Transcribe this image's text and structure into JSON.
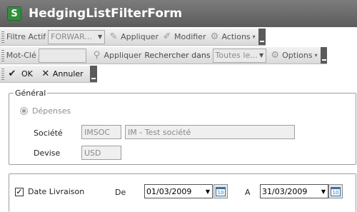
{
  "window": {
    "title": "HedgingListFilterForm",
    "icon": "app-logo-icon"
  },
  "toolbar1": {
    "filter_label": "Filtre Actif",
    "filter_value": "FORWAR...",
    "apply_label": "Appliquer",
    "modify_label": "Modifier",
    "actions_label": "Actions"
  },
  "toolbar2": {
    "keyword_label": "Mot-Clé",
    "keyword_value": "",
    "apply_label": "Appliquer",
    "search_in_label": "Rechercher dans",
    "search_in_value": "Toutes le...",
    "options_label": "Options"
  },
  "toolbar3": {
    "ok_label": "OK",
    "cancel_label": "Annuler"
  },
  "general": {
    "legend": "Général",
    "radio_label": "Dépenses",
    "societe_label": "Société",
    "societe_code": "IMSOC",
    "societe_name": "IM - Test société",
    "devise_label": "Devise",
    "devise_value": "USD"
  },
  "date_section": {
    "checkbox_label": "Date Livraison",
    "checked": true,
    "from_label": "De",
    "from_value": "01/03/2009",
    "to_label": "A",
    "to_value": "31/03/2009"
  },
  "colors": {
    "titlebar": "#6b6b6b",
    "toolbar": "#e4e4e4",
    "border": "#9e9e9e"
  }
}
